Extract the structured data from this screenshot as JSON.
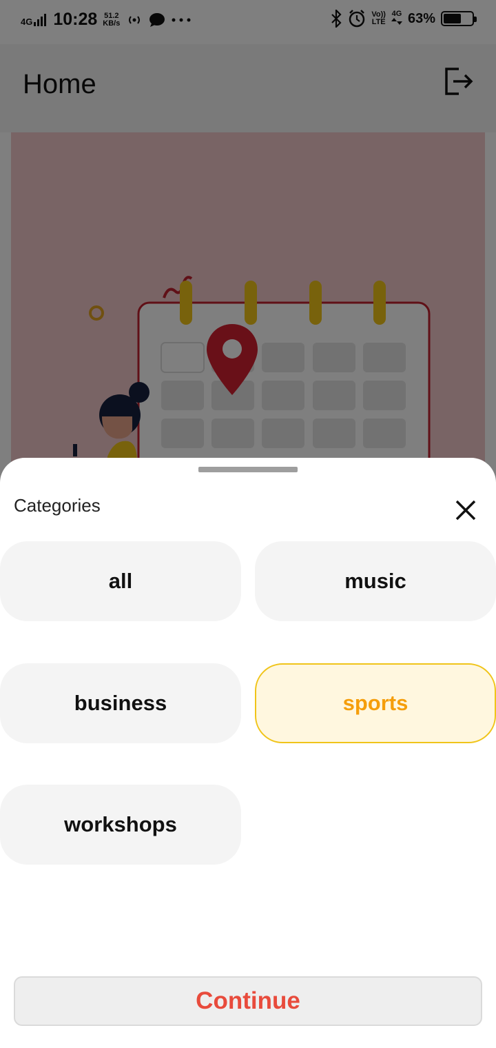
{
  "status_bar": {
    "network": "4G",
    "time": "10:28",
    "speed_value": "51.2",
    "speed_unit": "KB/s",
    "volte_top": "Vo))",
    "volte_bottom": "LTE",
    "net_right": "4G",
    "battery_percent": "63%",
    "battery_level": 0.63
  },
  "app_bar": {
    "title": "Home",
    "logout_icon": "logout-icon"
  },
  "colors": {
    "accent": "#f59e0b",
    "selected_border": "#f0c419",
    "continue_text": "#e84b3c",
    "hero_background": "#f3c9cb"
  },
  "categories_sheet": {
    "title": "Categories",
    "close_icon": "close-icon",
    "chips": [
      {
        "label": "all",
        "selected": false
      },
      {
        "label": "music",
        "selected": false
      },
      {
        "label": "business",
        "selected": false
      },
      {
        "label": "sports",
        "selected": true
      },
      {
        "label": "workshops",
        "selected": false
      }
    ],
    "continue_label": "Continue"
  }
}
